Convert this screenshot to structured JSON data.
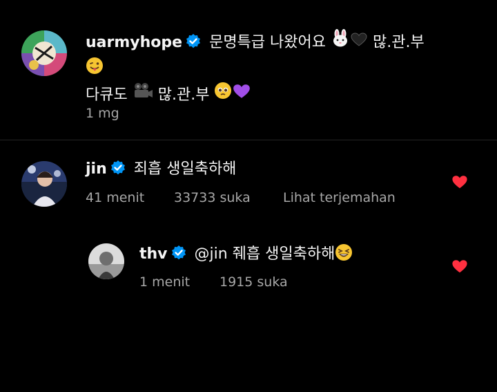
{
  "post": {
    "username": "uarmyhope",
    "caption_line1": "문명특급 나왔어요",
    "caption_after_emoji": "많.관.부",
    "caption_line2": "다큐도",
    "caption_line2_after": "많.관.부",
    "time": "1 mg",
    "emojis": [
      "rabbit-face-emoji",
      "black-heart-emoji",
      "winking-tongue-face-emoji",
      "film-camera-emoji",
      "pleading-face-emoji",
      "purple-heart-emoji"
    ]
  },
  "comments": [
    {
      "username": "jin",
      "text": "죄흡 생일축하해",
      "time": "41 menit",
      "likes": "33733 suka",
      "translate": "Lihat terjemahan"
    },
    {
      "username": "thv",
      "text": "@jin 줴흡 생일축하해",
      "time": "1 menit",
      "likes": "1915 suka"
    }
  ],
  "colors": {
    "background": "#000000",
    "text": "#f5f5f5",
    "secondary_text": "#a8a8a8",
    "verified": "#0095f6",
    "heart": "#ff3040",
    "divider": "#262626"
  }
}
